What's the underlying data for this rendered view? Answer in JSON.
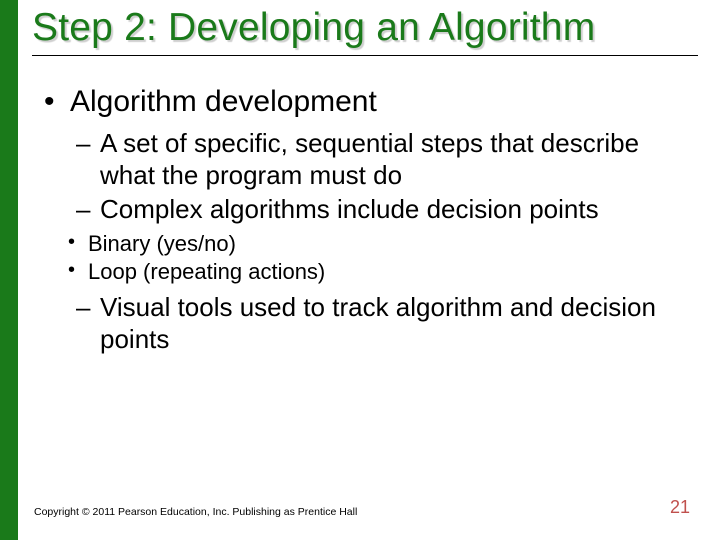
{
  "title": "Step 2: Developing an Algorithm",
  "bullets": {
    "l1_1": "Algorithm development",
    "l2_1": "A set of specific, sequential steps that describe what the program must do",
    "l2_2": "Complex algorithms include decision points",
    "l3_1": "Binary (yes/no)",
    "l3_2": "Loop (repeating actions)",
    "l2_3": "Visual tools used to track algorithm and decision points"
  },
  "footer": {
    "copyright": "Copyright © 2011 Pearson Education, Inc. Publishing as Prentice Hall",
    "page": "21"
  }
}
